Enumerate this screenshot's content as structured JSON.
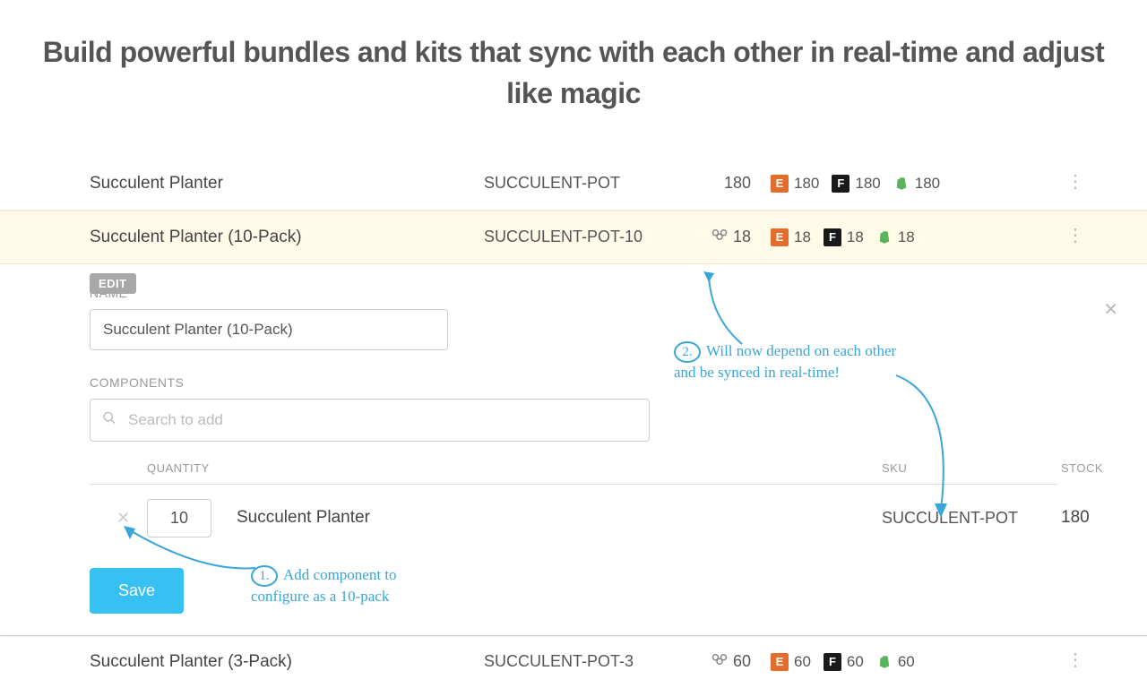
{
  "heading": "Build powerful bundles and kits that sync with each other in real-time and adjust like magic",
  "rows": [
    {
      "name": "Succulent Planter",
      "sku": "SUCCULENT-POT",
      "stock": "180",
      "bundle": false,
      "etsy": "180",
      "fba": "180",
      "shopify": "180"
    },
    {
      "name": "Succulent Planter (10-Pack)",
      "sku": "SUCCULENT-POT-10",
      "stock": "18",
      "bundle": true,
      "etsy": "18",
      "fba": "18",
      "shopify": "18"
    },
    {
      "name": "Succulent Planter (3-Pack)",
      "sku": "SUCCULENT-POT-3",
      "stock": "60",
      "bundle": true,
      "etsy": "60",
      "fba": "60",
      "shopify": "60"
    }
  ],
  "edit": {
    "tag": "EDIT",
    "name_label": "NAME",
    "name_value": "Succulent Planter (10-Pack)",
    "components_label": "COMPONENTS",
    "search_placeholder": "Search to add",
    "headers": {
      "qty": "QUANTITY",
      "sku": "SKU",
      "stock": "STOCK"
    },
    "component": {
      "qty": "10",
      "name": "Succulent Planter",
      "sku": "SUCCULENT-POT",
      "stock": "180"
    },
    "save_label": "Save"
  },
  "annotations": {
    "a1": {
      "num": "1.",
      "text": "Add component to configure as a 10-pack"
    },
    "a2": {
      "num": "2.",
      "text": "Will now depend on each other and be synced in real-time!"
    }
  }
}
